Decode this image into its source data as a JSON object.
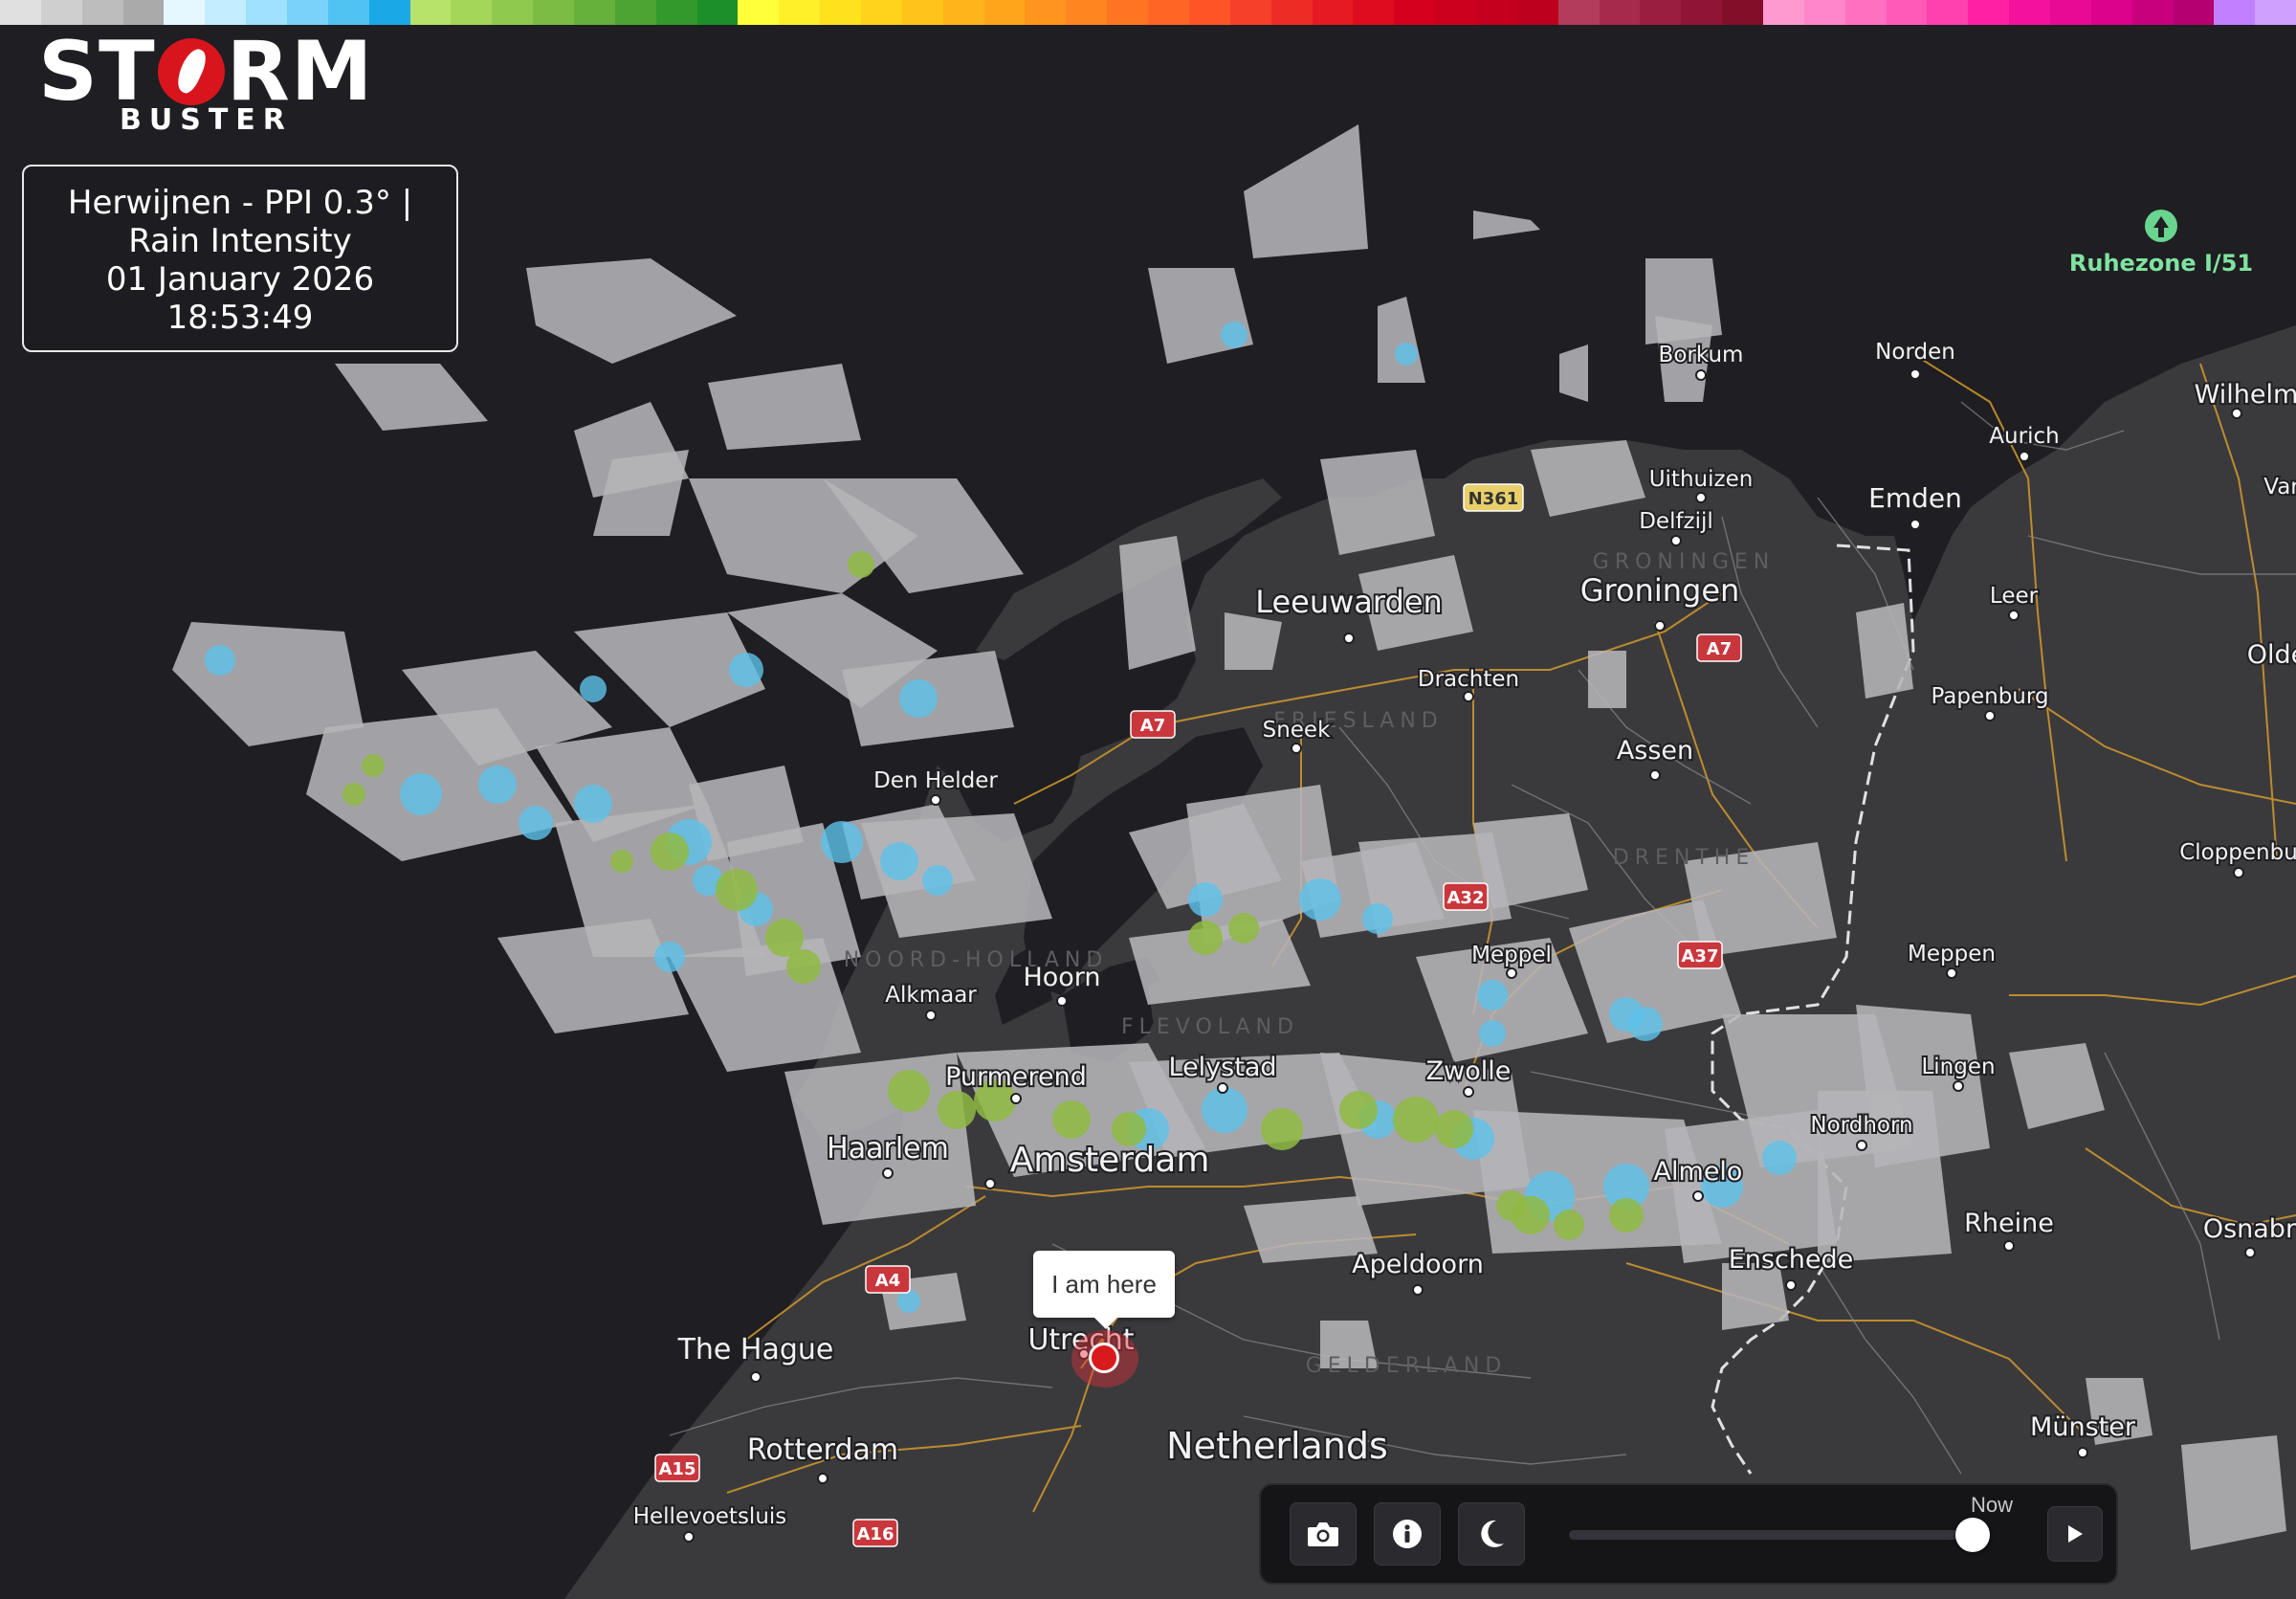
{
  "color_scale": [
    "#e0e0e0",
    "#cfcfcf",
    "#bdbdbd",
    "#aaaaaa",
    "#e6f8ff",
    "#c4eeff",
    "#9fe1ff",
    "#7ad2fb",
    "#50c3f3",
    "#1aa9e6",
    "#b7e36a",
    "#a4d65a",
    "#8fca4e",
    "#7bbd44",
    "#66b13b",
    "#4ea432",
    "#33992c",
    "#1c8f2a",
    "#ffff3a",
    "#fff02a",
    "#ffe11c",
    "#ffd21c",
    "#ffc31c",
    "#ffb41c",
    "#ffa51c",
    "#ff951e",
    "#ff8520",
    "#ff7522",
    "#ff6524",
    "#ff5526",
    "#f7402a",
    "#ee2c26",
    "#e61a22",
    "#dd0c1e",
    "#d4001e",
    "#cc001e",
    "#c4001e",
    "#bc001e",
    "#b23c5a",
    "#a62a4c",
    "#9a1e40",
    "#8e1634",
    "#820e2a",
    "#ff9ad0",
    "#ff86c8",
    "#ff70c0",
    "#ff5ab8",
    "#ff40ae",
    "#ff20a4",
    "#f4129c",
    "#e80a94",
    "#dc028c",
    "#c8007e",
    "#b40070",
    "#c080ff",
    "#d0a0ff"
  ],
  "logo": {
    "main": "ST RM",
    "sub": "BUSTER",
    "left": "ST",
    "right": "RM"
  },
  "info": {
    "line1": "Herwijnen - PPI 0.3° |",
    "line2": "Rain Intensity",
    "line3": "01 January 2026",
    "line4": "18:53:49"
  },
  "marker": {
    "tooltip": "I am here"
  },
  "poi": {
    "label": "Ruhezone I/51"
  },
  "cities": [
    {
      "name": "Leeuwarden",
      "size": 32
    },
    {
      "name": "Groningen",
      "size": 32
    },
    {
      "name": "Amsterdam",
      "size": 36
    },
    {
      "name": "Netherlands",
      "size": 38
    },
    {
      "name": "Emden",
      "size": 28
    },
    {
      "name": "The Hague",
      "size": 30
    },
    {
      "name": "Rotterdam",
      "size": 30
    },
    {
      "name": "Utrecht",
      "size": 30
    },
    {
      "name": "Haarlem",
      "size": 30
    },
    {
      "name": "Purmerend",
      "size": 27
    },
    {
      "name": "Lelystad",
      "size": 27
    },
    {
      "name": "Zwolle",
      "size": 27
    },
    {
      "name": "Almelo",
      "size": 27
    },
    {
      "name": "Enschede",
      "size": 27
    },
    {
      "name": "Apeldoorn",
      "size": 27
    },
    {
      "name": "Hoorn",
      "size": 27
    },
    {
      "name": "Alkmaar",
      "size": 23
    },
    {
      "name": "Den Helder",
      "size": 23
    },
    {
      "name": "Sneek",
      "size": 23
    },
    {
      "name": "Drachten",
      "size": 23
    },
    {
      "name": "Assen",
      "size": 27
    },
    {
      "name": "Meppel",
      "size": 23
    },
    {
      "name": "Borkum",
      "size": 23
    },
    {
      "name": "Norden",
      "size": 23
    },
    {
      "name": "Aurich",
      "size": 23
    },
    {
      "name": "Uithuizen",
      "size": 23
    },
    {
      "name": "Delfzijl",
      "size": 23
    },
    {
      "name": "Leer",
      "size": 23
    },
    {
      "name": "Papenburg",
      "size": 23
    },
    {
      "name": "Wilhelms",
      "size": 27
    },
    {
      "name": "Olde",
      "size": 27
    },
    {
      "name": "Var",
      "size": 23
    },
    {
      "name": "Cloppenbu",
      "size": 23
    },
    {
      "name": "Meppen",
      "size": 23
    },
    {
      "name": "Lingen",
      "size": 23
    },
    {
      "name": "Nordhorn",
      "size": 23
    },
    {
      "name": "Rheine",
      "size": 27
    },
    {
      "name": "Osnabrü",
      "size": 27
    },
    {
      "name": "Münster",
      "size": 27
    },
    {
      "name": "Hellevoetsluis",
      "size": 23
    }
  ],
  "roads": [
    "A7",
    "A7",
    "N361",
    "A32",
    "A37",
    "A4",
    "A15",
    "A16"
  ],
  "region_labels": [
    "GRONINGEN",
    "FRIESLAND",
    "DRENTHE",
    "FLEVOLAND",
    "GELDERLAND",
    "NOORD-HOLLAND"
  ],
  "timeline": {
    "now_label": "Now",
    "position_fraction": 1.0
  },
  "toolbar": {
    "camera_icon": "camera-icon",
    "info_icon": "info-icon",
    "dark_mode_icon": "moon-icon",
    "play_icon": "play-icon"
  }
}
